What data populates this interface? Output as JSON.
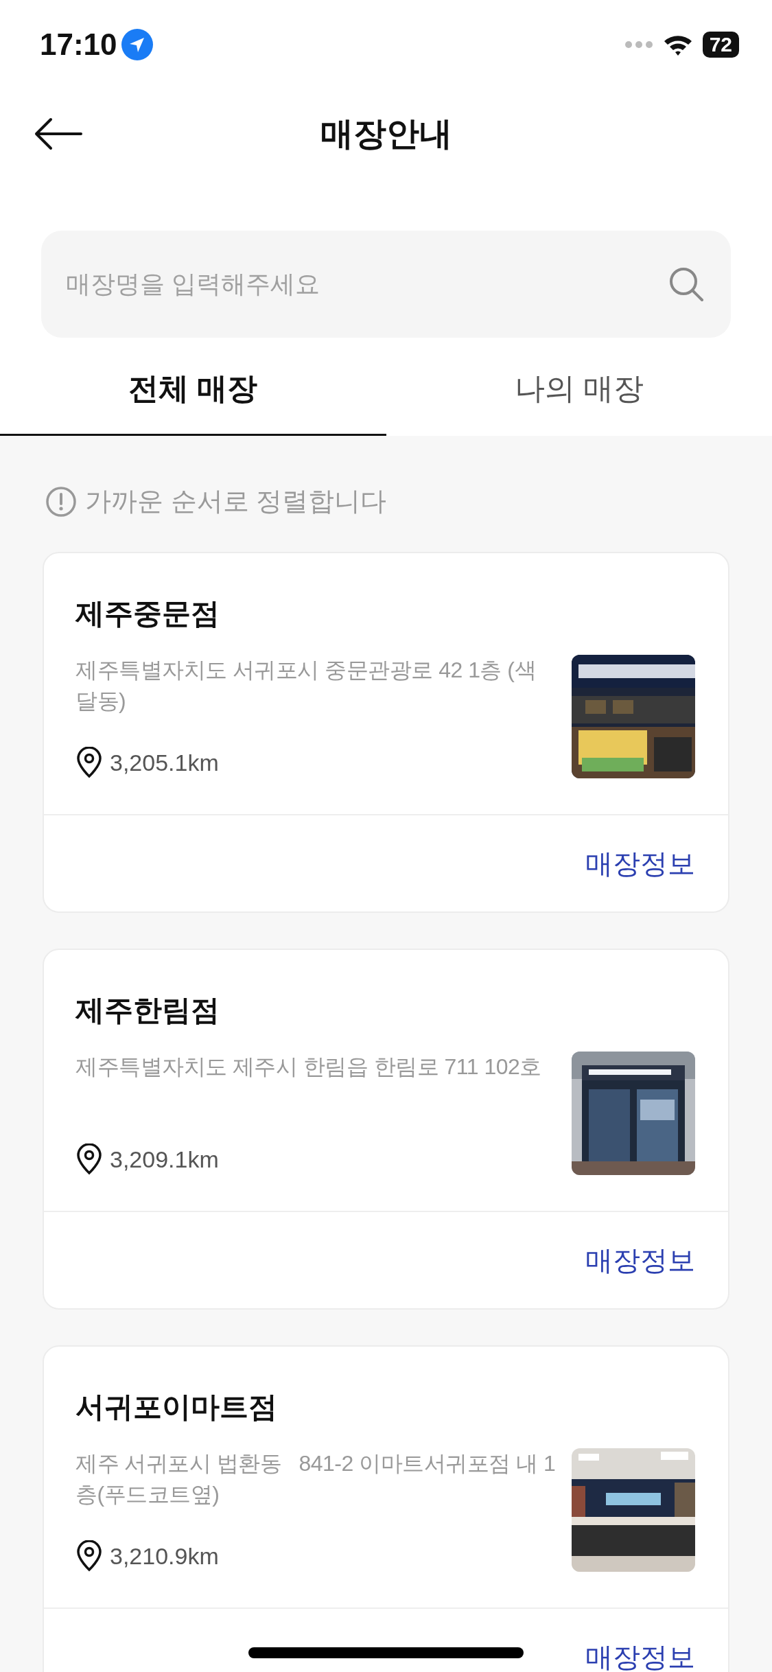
{
  "status_bar": {
    "time": "17:10",
    "battery": "72"
  },
  "header": {
    "title": "매장안내"
  },
  "search": {
    "placeholder": "매장명을 입력해주세요"
  },
  "tabs": [
    {
      "label": "전체 매장",
      "selected": true
    },
    {
      "label": "나의 매장",
      "selected": false
    }
  ],
  "notice": "가까운 순서로 정렬합니다",
  "stores": [
    {
      "name": "제주중문점",
      "address": "제주특별자치도 서귀포시 중문관광로 42 1층 (색달동)",
      "distance": "3,205.1km",
      "link": "매장정보"
    },
    {
      "name": "제주한림점",
      "address": "제주특별자치도 제주시 한림읍 한림로 711 102호",
      "distance": "3,209.1km",
      "link": "매장정보"
    },
    {
      "name": "서귀포이마트점",
      "address": "제주 서귀포시 법환동   841-2 이마트서귀포점 내 1층(푸드코트옆)",
      "distance": "3,210.9km",
      "link": "매장정보"
    }
  ]
}
